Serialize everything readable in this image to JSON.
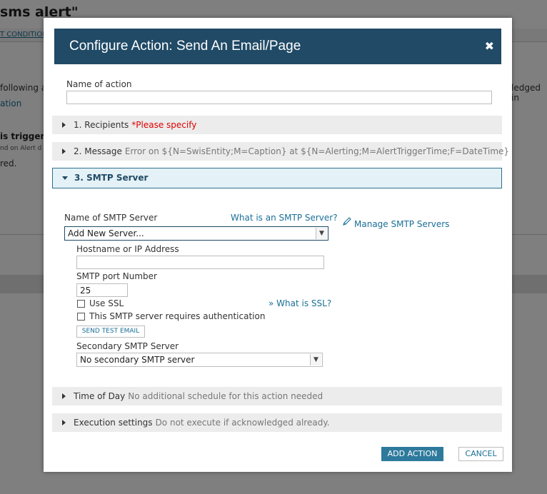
{
  "background": {
    "title": "sms alert\"",
    "link": "T CONDITION",
    "line1_left": "following a",
    "line1_right": "ledged in",
    "line2": "ation",
    "bold_line": "is triggerec",
    "small_line": "nd on Alert d",
    "line3": "red."
  },
  "modal": {
    "title": "Configure Action: Send An Email/Page",
    "close_symbol": "✖",
    "name_of_action_label": "Name of action",
    "name_of_action_value": "",
    "sections": {
      "recipients": {
        "label": "1. Recipients",
        "warning": "*Please specify"
      },
      "message": {
        "label": "2. Message",
        "summary": "Error on ${N=SwisEntity;M=Caption} at ${N=Alerting;M=AlertTriggerTime;F=DateTime}"
      },
      "smtp": {
        "label": "3. SMTP Server"
      },
      "time_of_day": {
        "label": "Time of Day",
        "summary": "No additional schedule for this action needed"
      },
      "execution": {
        "label": "Execution settings",
        "summary": "Do not execute if acknowledged already."
      }
    },
    "smtp": {
      "server_name_label": "Name of SMTP Server",
      "what_is_smtp_link": "What is an SMTP Server?",
      "server_selected": "Add New Server...",
      "manage_link": "Manage SMTP Servers",
      "hostname_label": "Hostname or IP Address",
      "hostname_value": "",
      "port_label": "SMTP port Number",
      "port_value": "25",
      "use_ssl_label": "Use SSL",
      "what_is_ssl_link": "» What is SSL?",
      "auth_label": "This SMTP server requires authentication",
      "send_test_label": "SEND TEST EMAIL",
      "secondary_label": "Secondary SMTP Server",
      "secondary_selected": "No secondary SMTP server"
    },
    "buttons": {
      "add": "ADD ACTION",
      "cancel": "CANCEL"
    }
  }
}
